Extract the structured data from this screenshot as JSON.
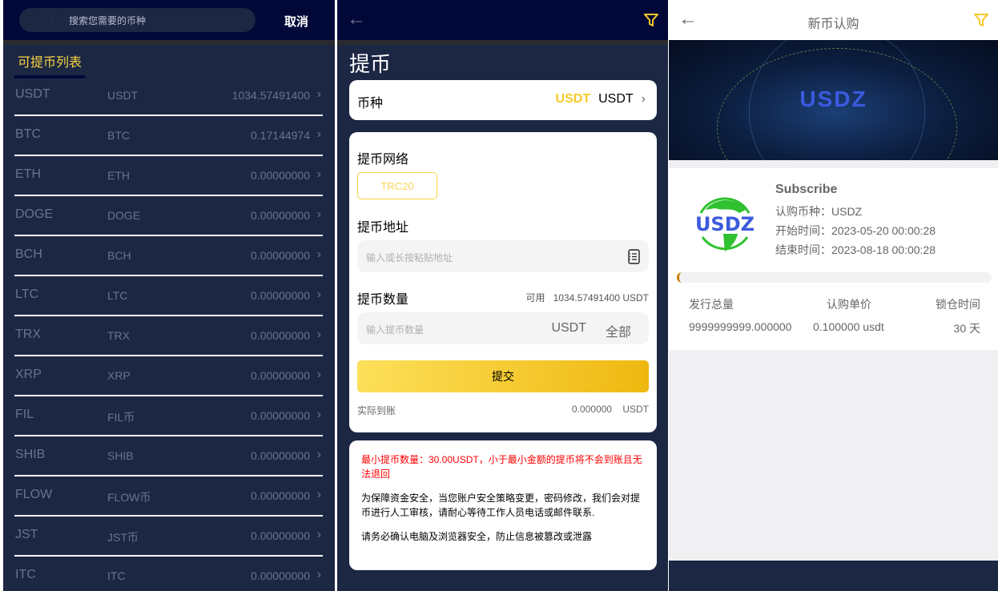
{
  "panel1": {
    "search_placeholder": "搜索您需要的币种",
    "cancel": "取消",
    "list_title": "可提币列表",
    "coins": [
      {
        "name": "USDT",
        "sub": "USDT",
        "balance": "1034.57491400"
      },
      {
        "name": "BTC",
        "sub": "BTC",
        "balance": "0.17144974"
      },
      {
        "name": "ETH",
        "sub": "ETH",
        "balance": "0.00000000"
      },
      {
        "name": "DOGE",
        "sub": "DOGE",
        "balance": "0.00000000"
      },
      {
        "name": "BCH",
        "sub": "BCH",
        "balance": "0.00000000"
      },
      {
        "name": "LTC",
        "sub": "LTC",
        "balance": "0.00000000"
      },
      {
        "name": "TRX",
        "sub": "TRX",
        "balance": "0.00000000"
      },
      {
        "name": "XRP",
        "sub": "XRP",
        "balance": "0.00000000"
      },
      {
        "name": "FIL",
        "sub": "FIL币",
        "balance": "0.00000000"
      },
      {
        "name": "SHIB",
        "sub": "SHIB",
        "balance": "0.00000000"
      },
      {
        "name": "FLOW",
        "sub": "FLOW币",
        "balance": "0.00000000"
      },
      {
        "name": "JST",
        "sub": "JST币",
        "balance": "0.00000000"
      },
      {
        "name": "ITC",
        "sub": "ITC",
        "balance": "0.00000000"
      }
    ]
  },
  "panel2": {
    "title": "提币",
    "coin_label": "币种",
    "coin_value_bold": "USDT",
    "coin_value": "USDT",
    "network_label": "提币网络",
    "network_option": "TRC20",
    "address_label": "提币地址",
    "address_placeholder": "输入或长按粘贴地址",
    "amount_label": "提币数量",
    "available_label": "可用",
    "available_value": "1034.57491400 USDT",
    "amount_placeholder": "输入提币数量",
    "amount_unit": "USDT",
    "all_button": "全部",
    "submit": "提交",
    "received_label": "实际到账",
    "received_value": "0.000000",
    "received_unit": "USDT",
    "notice_red": "最小提币数量：30.00USDT，小于最小金额的提币将不会到账且无法退回",
    "notice_1": "为保障资金安全，当您账户安全策略变更，密码修改，我们会对提币进行人工审核，请耐心等待工作人员电话或邮件联系.",
    "notice_2": "请务必确认电脑及浏览器安全，防止信息被篡改或泄露"
  },
  "panel3": {
    "title": "新币认购",
    "banner_text": "USDZ",
    "logo_text": "USDZ",
    "subscribe": "Subscribe",
    "coin": "认购币种：USDZ",
    "start": "开始时间：2023-05-20 00:00:28",
    "end": "结束时间：2023-08-18 00:00:28",
    "progress_percent": 0,
    "headers": [
      "发行总量",
      "认购单价",
      "锁仓时间"
    ],
    "values": [
      "9999999999.000000",
      "0.100000 usdt",
      "30 天"
    ]
  },
  "colors": {
    "accent": "#f7d43f",
    "navy": "#010838",
    "panel": "#1c2744",
    "warning": "#ff0000"
  }
}
